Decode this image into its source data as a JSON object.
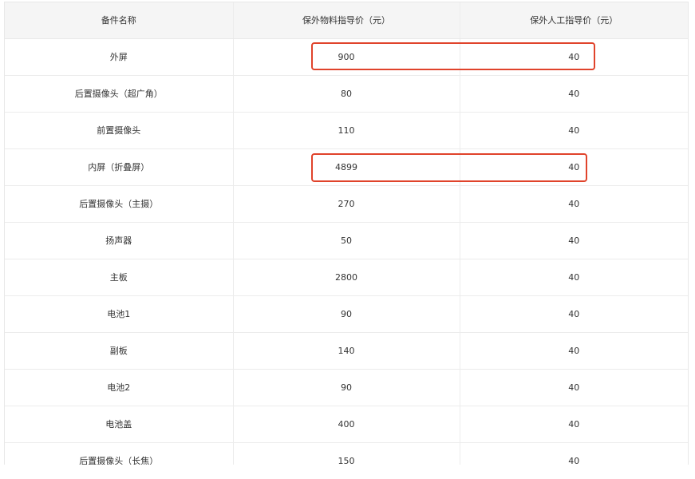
{
  "table": {
    "headers": [
      "备件名称",
      "保外物料指导价（元）",
      "保外人工指导价（元）"
    ],
    "rows": [
      [
        "外屏",
        "900",
        "40"
      ],
      [
        "后置摄像头（超广角）",
        "80",
        "40"
      ],
      [
        "前置摄像头",
        "110",
        "40"
      ],
      [
        "内屏（折叠屏）",
        "4899",
        "40"
      ],
      [
        "后置摄像头（主摄）",
        "270",
        "40"
      ],
      [
        "扬声器",
        "50",
        "40"
      ],
      [
        "主板",
        "2800",
        "40"
      ],
      [
        "电池1",
        "90",
        "40"
      ],
      [
        "副板",
        "140",
        "40"
      ],
      [
        "电池2",
        "90",
        "40"
      ],
      [
        "电池盖",
        "400",
        "40"
      ],
      [
        "后置摄像头（长焦）",
        "150",
        "40"
      ]
    ]
  },
  "highlight_color": "#e0432b",
  "highlighted_rows": [
    "外屏",
    "内屏（折叠屏）"
  ]
}
